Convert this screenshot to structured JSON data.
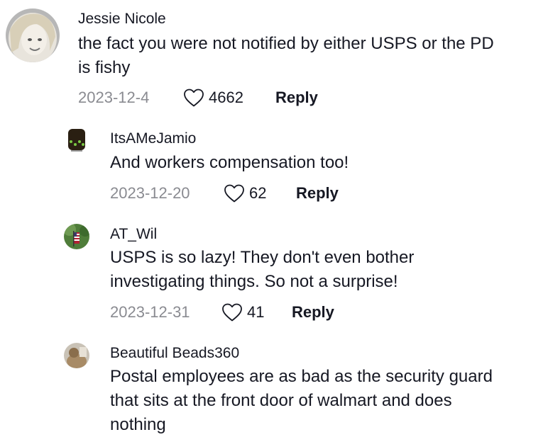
{
  "comments": [
    {
      "author": "Jessie Nicole",
      "text_lines": [
        "the fact you were not notified by either USPS or the PD",
        "is fishy"
      ],
      "date": "2023-12-4",
      "likes": "4662",
      "reply_label": "Reply"
    },
    {
      "author": "ItsAMeJamio",
      "text_lines": [
        "And workers compensation too!"
      ],
      "date": "2023-12-20",
      "likes": "62",
      "reply_label": "Reply"
    },
    {
      "author": "AT_Wil",
      "text_lines": [
        "USPS is so lazy! They don't even bother",
        "investigating things. So not a surprise!"
      ],
      "date": "2023-12-31",
      "likes": "41",
      "reply_label": "Reply"
    },
    {
      "author": "Beautiful Beads360",
      "text_lines": [
        "Postal employees are as bad as the security guard",
        "that sits at the front door of walmart and does",
        "nothing"
      ]
    }
  ],
  "icons": {
    "like": "heart-outline-icon"
  },
  "colors": {
    "text": "#161823",
    "secondary": "#8a8b91"
  }
}
